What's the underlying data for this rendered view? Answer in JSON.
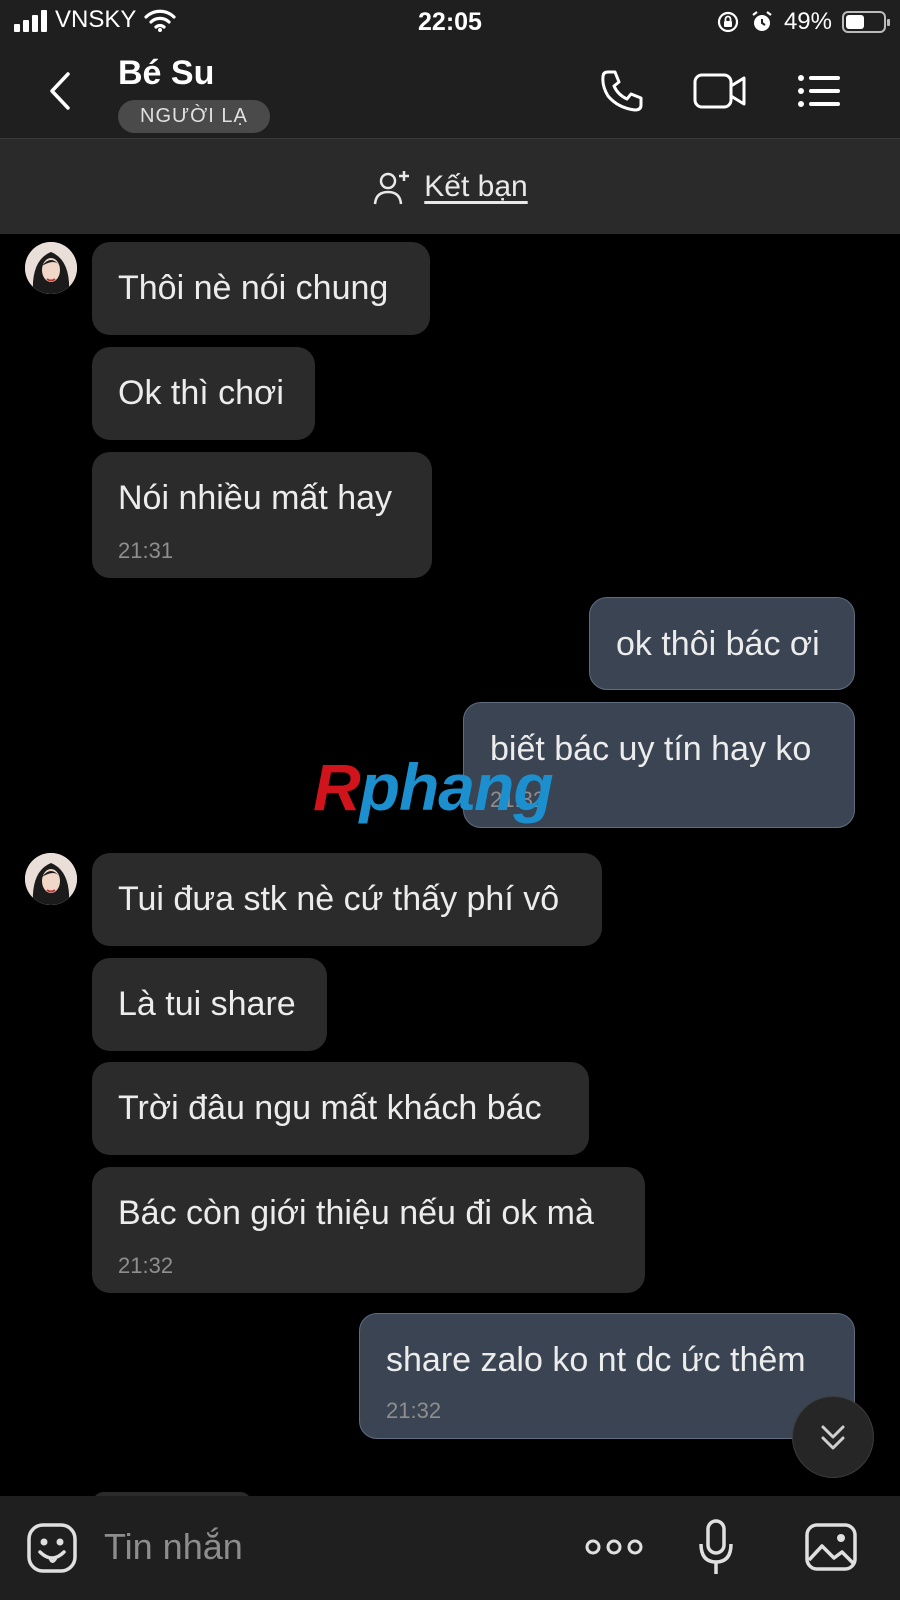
{
  "status_bar": {
    "carrier": "VNSKY",
    "time": "22:05",
    "battery": "49%",
    "battery_level": 0.49
  },
  "header": {
    "contact_name": "Bé Su",
    "contact_badge": "NGƯỜI LẠ"
  },
  "add_friend": {
    "label": "Kết bạn"
  },
  "messages": [
    {
      "side": "in",
      "text": "Thôi nè nói chung"
    },
    {
      "side": "in",
      "text": "Ok thì chơi"
    },
    {
      "side": "in",
      "text": "Nói nhiều mất hay",
      "time": "21:31"
    },
    {
      "side": "out",
      "text": "ok thôi bác ơi"
    },
    {
      "side": "out",
      "text": "biết bác uy tín hay ko",
      "time": "21:32"
    },
    {
      "side": "in",
      "text": "Tui đưa stk nè cứ thấy phí vô"
    },
    {
      "side": "in",
      "text": "Là tui share"
    },
    {
      "side": "in",
      "text": "Trời đâu ngu mất khách bác"
    },
    {
      "side": "in",
      "text": "Bác còn giới thiệu nếu đi ok mà",
      "time": "21:32"
    },
    {
      "side": "out",
      "text": "share zalo ko nt dc ức thêm",
      "time": "21:32"
    }
  ],
  "watermark": {
    "text_r": "R",
    "text_rest": "phang"
  },
  "composer": {
    "placeholder": "Tin nhắn"
  },
  "colors": {
    "incoming_bubble": "#2b2b2b",
    "outgoing_bubble": "#3a4452",
    "header_bg": "#1f1f1f"
  }
}
